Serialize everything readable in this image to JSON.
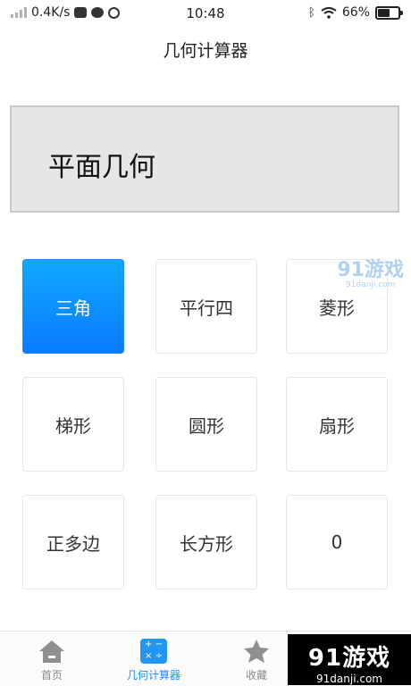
{
  "status_bar": {
    "network_speed": "0.4K/s",
    "time": "10:48",
    "battery": "66%",
    "battery_level": 0.66
  },
  "header": {
    "title": "几何计算器"
  },
  "display": {
    "text": "平面几何"
  },
  "buttons": [
    "三角",
    "平行四",
    "菱形",
    "梯形",
    "圆形",
    "扇形",
    "正多边",
    "长方形",
    "0"
  ],
  "tabs": [
    {
      "label": "首页",
      "icon": "home-icon"
    },
    {
      "label": "几何计算器",
      "icon": "calculator-icon",
      "active": true
    },
    {
      "label": "收藏",
      "icon": "star-icon"
    }
  ],
  "watermarks": {
    "top": "91游戏",
    "top_sub": "91danji.com",
    "bottom": "91游戏",
    "bottom_sub": "91danji.com"
  },
  "colors": {
    "accent": "#1a8cff",
    "display_bg": "#e6e6e6",
    "active_tab": "#1a8cff"
  }
}
